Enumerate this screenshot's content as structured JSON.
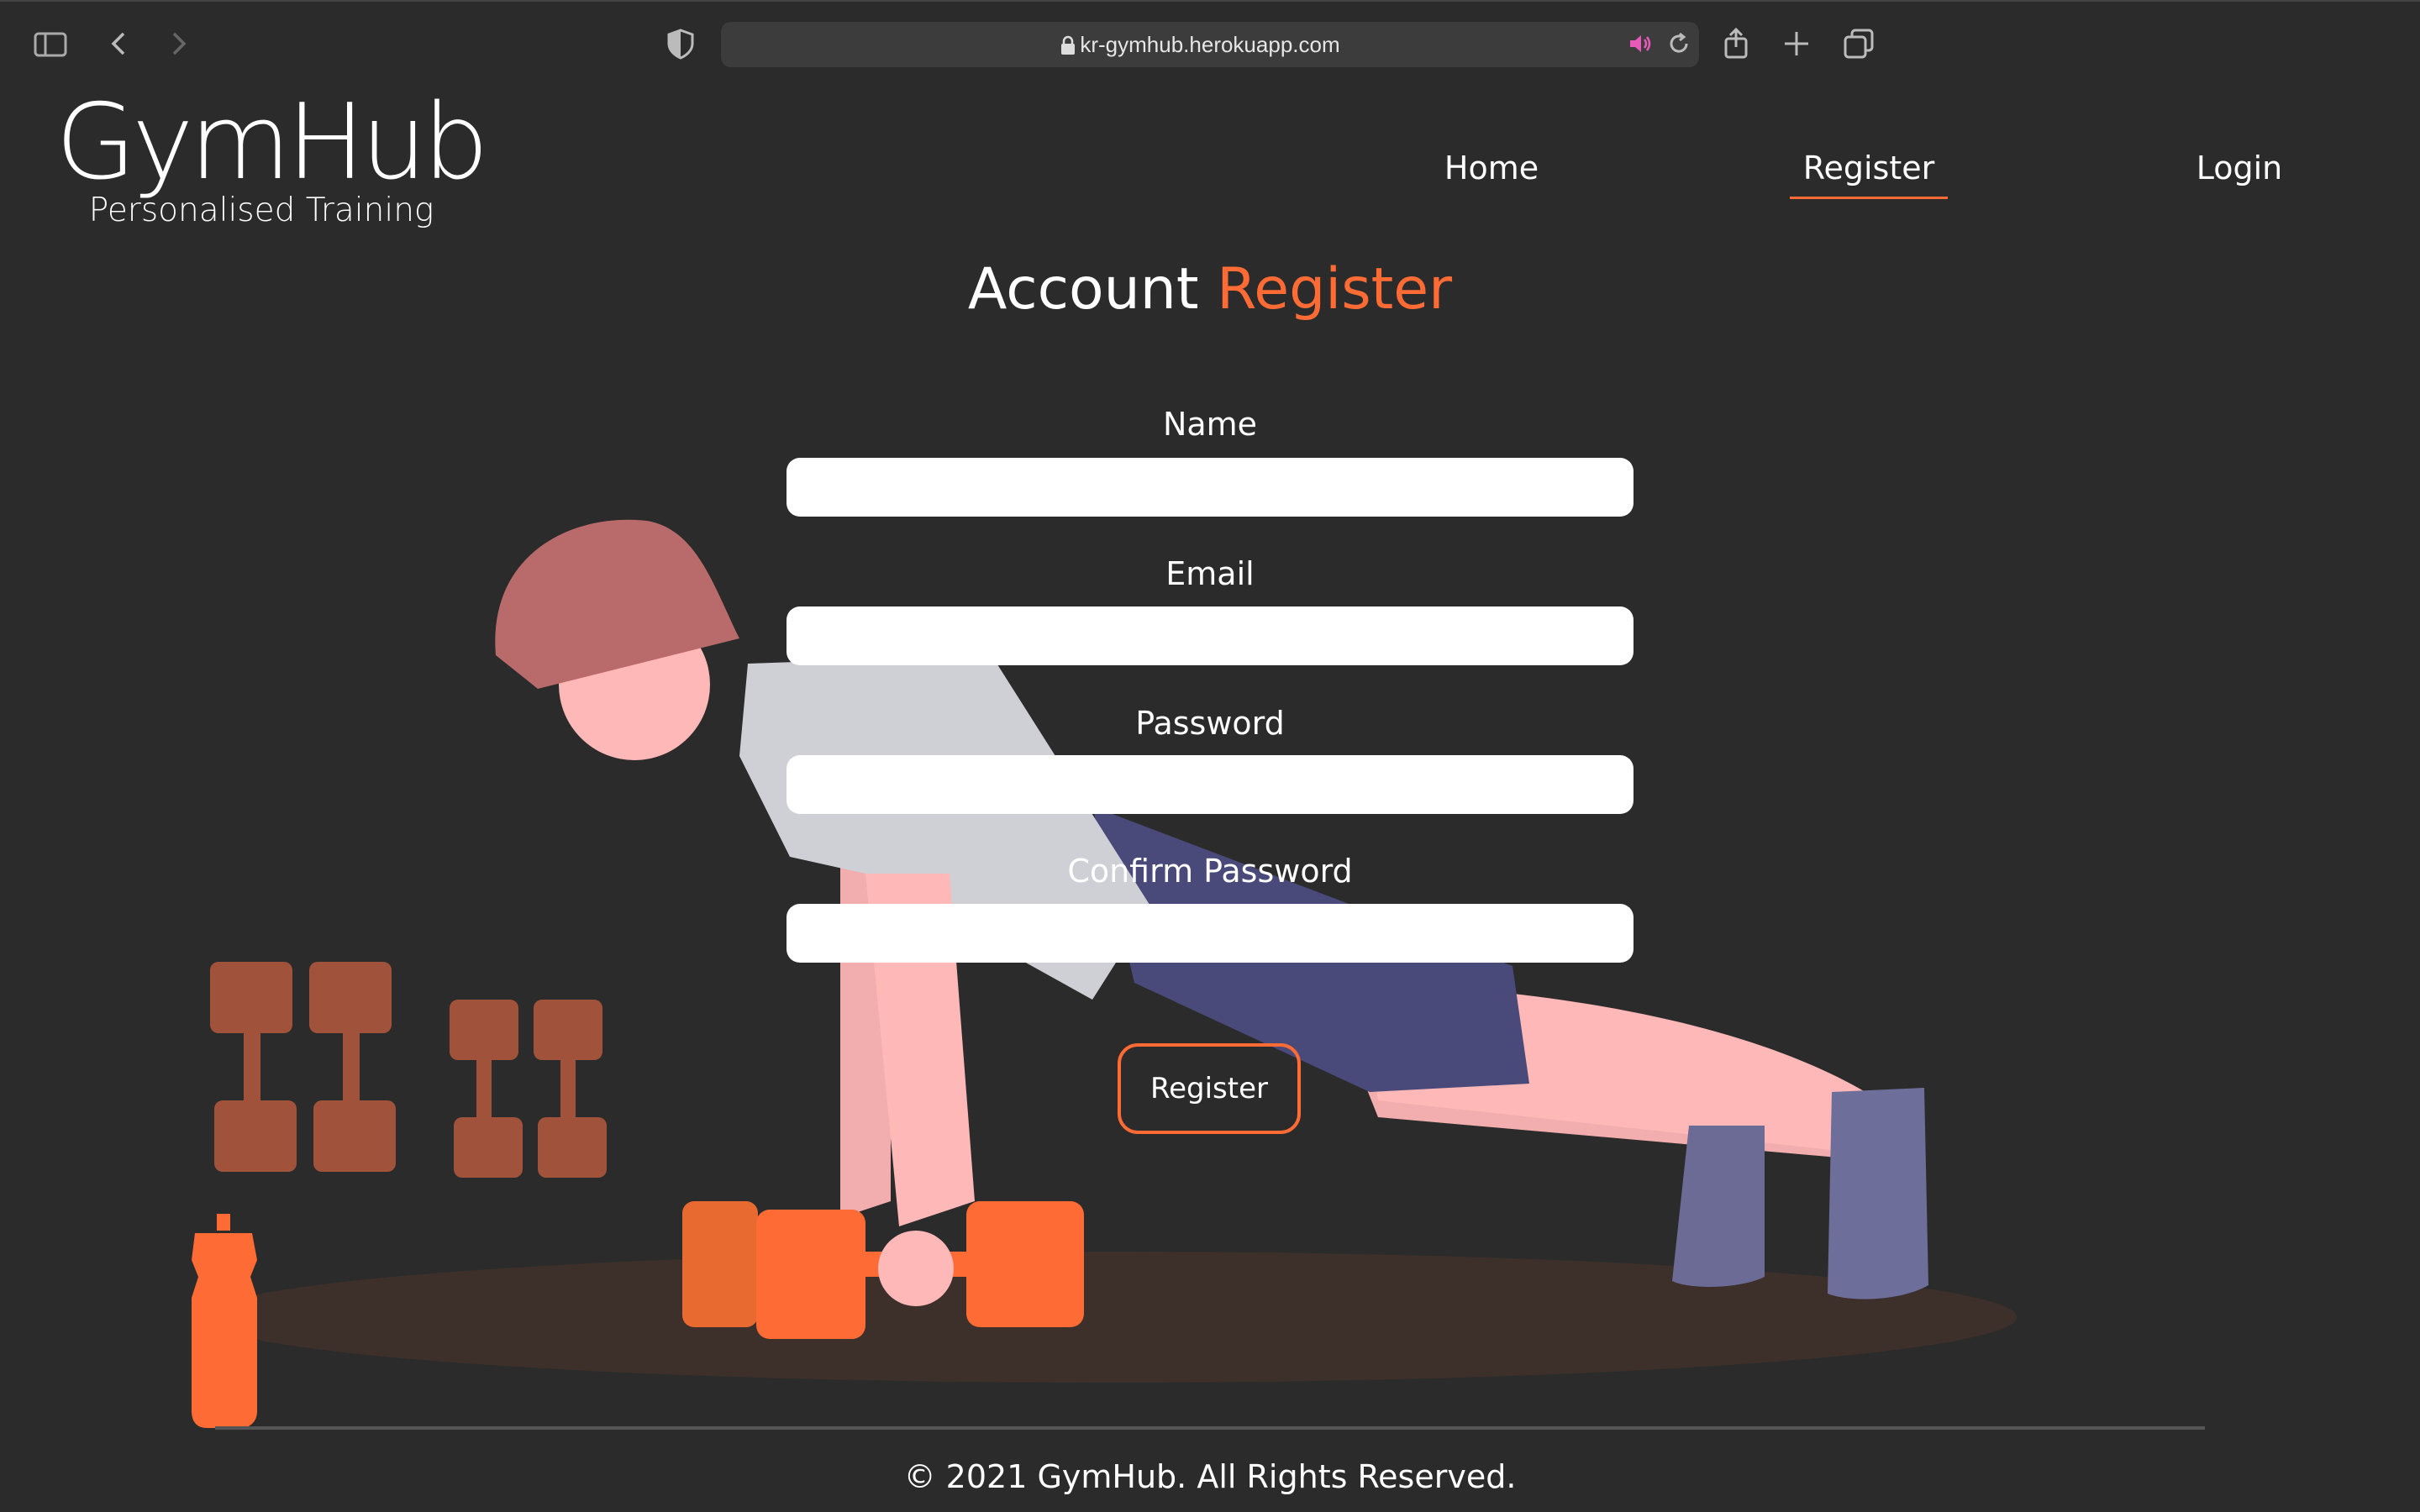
{
  "browser": {
    "url": "kr-gymhub.herokuapp.com"
  },
  "header": {
    "logo_title": "GymHub",
    "logo_subtitle": "Personalised Training",
    "nav": [
      {
        "label": "Home",
        "active": false
      },
      {
        "label": "Register",
        "active": true
      },
      {
        "label": "Login",
        "active": false
      }
    ]
  },
  "main": {
    "title_prefix": "Account",
    "title_accent": "Register",
    "fields": [
      {
        "label": "Name",
        "value": ""
      },
      {
        "label": "Email",
        "value": ""
      },
      {
        "label": "Password",
        "value": ""
      },
      {
        "label": "Confirm Password",
        "value": ""
      }
    ],
    "submit_label": "Register"
  },
  "footer": {
    "text": "© 2021 GymHub. All Rights Reserved."
  },
  "colors": {
    "background": "#2b2b2b",
    "accent": "#ff6b35",
    "floor_shadow": "#3d302b"
  }
}
